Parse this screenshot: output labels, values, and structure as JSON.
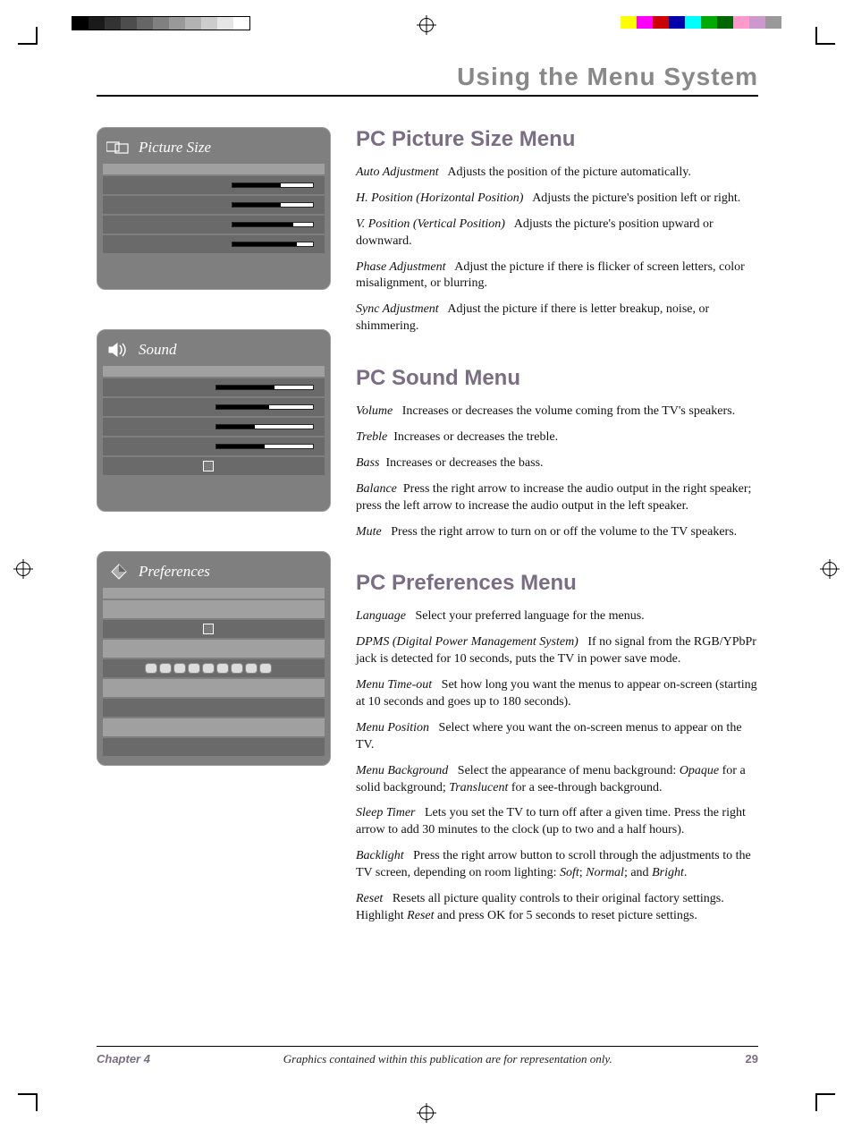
{
  "page_header": "Using the Menu System",
  "osd": {
    "picture_size": {
      "title": "Picture Size"
    },
    "sound": {
      "title": "Sound"
    },
    "preferences": {
      "title": "Preferences"
    }
  },
  "sections": {
    "picture_size": {
      "heading": "PC Picture Size Menu",
      "items": [
        {
          "term": "Auto Adjustment",
          "desc": "Adjusts the position of the picture automatically."
        },
        {
          "term": "H. Position (Horizontal Position)",
          "desc": "Adjusts the picture's position left or right."
        },
        {
          "term": "V. Position (Vertical Position)",
          "desc": "Adjusts the picture's position upward or downward."
        },
        {
          "term": "Phase Adjustment",
          "desc": "Adjust the picture if there is flicker of screen letters, color misalignment, or blurring."
        },
        {
          "term": "Sync Adjustment",
          "desc": "Adjust the picture if there is letter breakup, noise, or shimmering."
        }
      ]
    },
    "sound": {
      "heading": "PC Sound Menu",
      "items": [
        {
          "term": "Volume",
          "desc": "Increases or decreases the volume coming from the TV's speakers."
        },
        {
          "term": "Treble",
          "desc": "Increases or decreases the treble."
        },
        {
          "term": "Bass",
          "desc": "Increases or decreases the bass."
        },
        {
          "term": "Balance",
          "desc": "Press the right arrow to increase the audio output in the right speaker; press the left arrow to increase the audio output in the left speaker."
        },
        {
          "term": "Mute",
          "desc": "Press the right arrow to turn on or off the volume to the TV speakers."
        }
      ]
    },
    "preferences": {
      "heading": "PC Preferences Menu",
      "items": [
        {
          "term": "Language",
          "desc": "Select your preferred language for the menus."
        },
        {
          "term": "DPMS (Digital Power Management System)",
          "desc": "If no signal from the RGB/YPbPr jack is detected for 10 seconds, puts the TV in power save mode."
        },
        {
          "term": "Menu Time-out",
          "desc": "Set how long you want the menus to appear on-screen (starting at 10 seconds and goes up to 180 seconds)."
        },
        {
          "term": "Menu Position",
          "desc": "Select where you want the on-screen menus to appear on the TV."
        },
        {
          "term": "Menu Background",
          "desc_html": "Select the appearance of menu background: <i>Opaque</i> for a solid background; <i>Translucent</i> for a see-through background."
        },
        {
          "term": "Sleep Timer",
          "desc": "Lets you set the TV to turn off after a given time. Press the right arrow to add 30 minutes to the clock (up to two and a half hours)."
        },
        {
          "term": "Backlight",
          "desc_html": "Press the right arrow button to scroll through the adjustments to the TV screen, depending on room lighting: <i>Soft</i>; <i>Normal</i>; and <i>Bright</i>."
        },
        {
          "term": "Reset",
          "desc_html": "Resets all picture quality controls to their original factory settings. Highlight <i>Reset</i> and press OK for 5 seconds to reset picture settings."
        }
      ]
    }
  },
  "footer": {
    "chapter": "Chapter 4",
    "note": "Graphics contained within this publication are for representation only.",
    "page": "29"
  }
}
